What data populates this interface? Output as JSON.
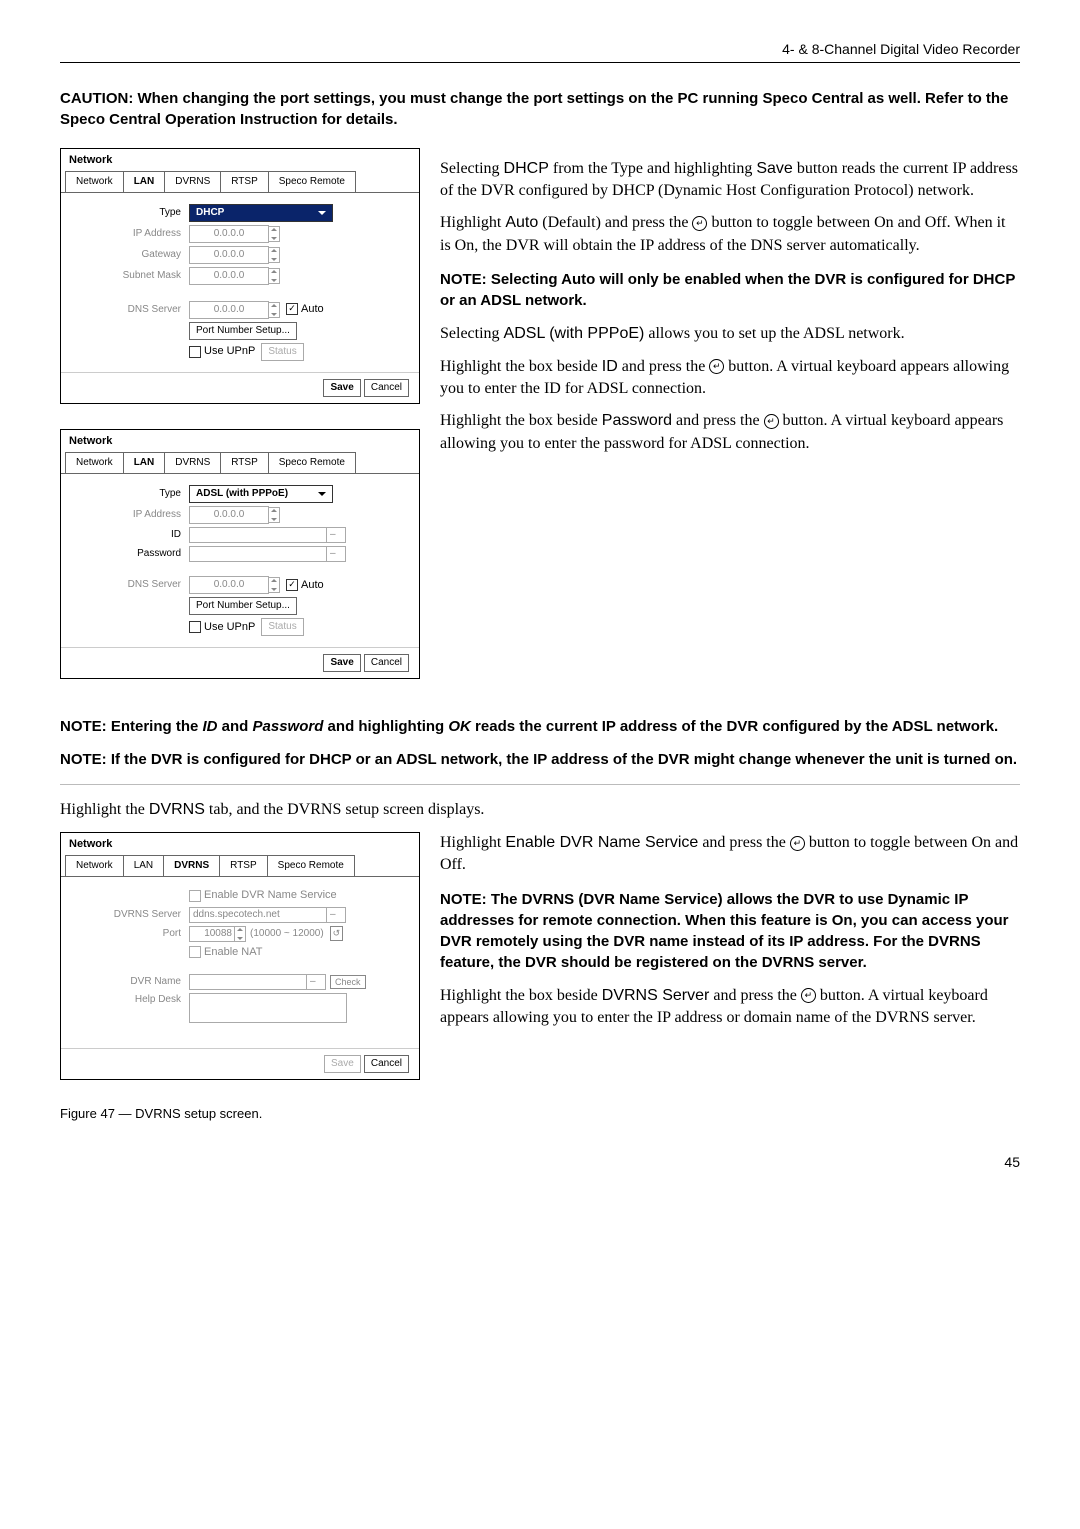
{
  "header": "4- & 8-Channel Digital Video Recorder",
  "caution": "CAUTION:  When changing the port settings, you must change the port settings on the PC running Speco Central as well.  Refer to the Speco Central Operation Instruction for details.",
  "tabs": {
    "network": "Network",
    "lan": "LAN",
    "dvrns": "DVRNS",
    "rtsp": "RTSP",
    "speco": "Speco Remote"
  },
  "dialog1": {
    "title": "Network",
    "type_label": "Type",
    "type_value": "DHCP",
    "ip_address_label": "IP Address",
    "ip_address_value": "0.0.0.0",
    "gateway_label": "Gateway",
    "gateway_value": "0.0.0.0",
    "subnet_label": "Subnet Mask",
    "subnet_value": "0.0.0.0",
    "dns_label": "DNS Server",
    "dns_value": "0.0.0.0",
    "auto": "Auto",
    "port_setup": "Port Number Setup...",
    "use_upnp": "Use UPnP",
    "status": "Status",
    "save": "Save",
    "cancel": "Cancel"
  },
  "dialog2": {
    "title": "Network",
    "type_label": "Type",
    "type_value": "ADSL (with PPPoE)",
    "ip_address_label": "IP Address",
    "ip_address_value": "0.0.0.0",
    "id_label": "ID",
    "password_label": "Password",
    "dns_label": "DNS Server",
    "dns_value": "0.0.0.0",
    "auto": "Auto",
    "port_setup": "Port Number Setup...",
    "use_upnp": "Use UPnP",
    "status": "Status",
    "save": "Save",
    "cancel": "Cancel"
  },
  "dialog3": {
    "title": "Network",
    "enable_service": "Enable DVR Name Service",
    "dvrns_server_label": "DVRNS Server",
    "dvrns_server_value": "ddns.specotech.net",
    "port_label": "Port",
    "port_value": "10088",
    "port_range": "(10000 ~ 12000)",
    "enable_nat": "Enable NAT",
    "dvr_name_label": "DVR Name",
    "check": "Check",
    "help_desk_label": "Help Desk",
    "save": "Save",
    "cancel": "Cancel"
  },
  "right1": {
    "p1a": "Selecting ",
    "p1b": "DHCP",
    "p1c": " from the Type and highlighting ",
    "p1d": "Save",
    "p1e": " button reads the current IP address of the DVR configured by DHCP (Dynamic Host Configuration Protocol) network.",
    "p2a": "Highlight ",
    "p2b": "Auto",
    "p2c": " (Default) and press the ",
    "p2d": " button to toggle between On and Off.  When it is On, the DVR will obtain the IP address of the DNS server automatically.",
    "note1": "NOTE:  Selecting Auto will only be enabled when the DVR is configured for DHCP or an ADSL network.",
    "p3a": "Selecting ",
    "p3b": "ADSL (with PPPoE)",
    "p3c": " allows you to set up the ADSL network.",
    "p4a": "Highlight the box beside ",
    "p4b": "ID",
    "p4c": " and press the ",
    "p4d": " button.  A virtual keyboard appears allowing you to enter the ID for ADSL connection.",
    "p5a": "Highlight the box beside ",
    "p5b": "Password",
    "p5c": " and press the ",
    "p5d": " button.  A virtual keyboard appears allowing you to enter the password for ADSL connection."
  },
  "note2a": "NOTE:  Entering the ",
  "note2_id": "ID",
  "note2b": " and ",
  "note2_pw": "Password",
  "note2c": " and highlighting ",
  "note2_ok": "OK",
  "note2d": " reads the current IP address of the DVR configured by the ADSL network.",
  "note3": "NOTE:  If the DVR is configured for DHCP or an ADSL network, the IP address of the DVR might change whenever the unit is turned on.",
  "mid_text_a": "Highlight the ",
  "mid_text_b": "DVRNS",
  "mid_text_c": " tab, and the DVRNS setup screen displays.",
  "right3": {
    "p1a": "Highlight ",
    "p1b": "Enable DVR Name Service",
    "p1c": " and press the ",
    "p1d": " button to toggle between On and Off.",
    "note": "NOTE:  The DVRNS (DVR Name Service) allows the DVR to use Dynamic IP addresses for remote connection.  When this feature is On, you can access your DVR remotely using the DVR name instead of its IP address.  For the DVRNS feature, the DVR should be registered on the DVRNS server.",
    "p2a": "Highlight the box beside ",
    "p2b": "DVRNS Server",
    "p2c": " and press the ",
    "p2d": " button.  A virtual keyboard appears allowing you to enter the IP address or domain name of the DVRNS server."
  },
  "figure_caption": "Figure 47 — DVRNS setup screen.",
  "page_number": "45",
  "enter_glyph": "↵"
}
